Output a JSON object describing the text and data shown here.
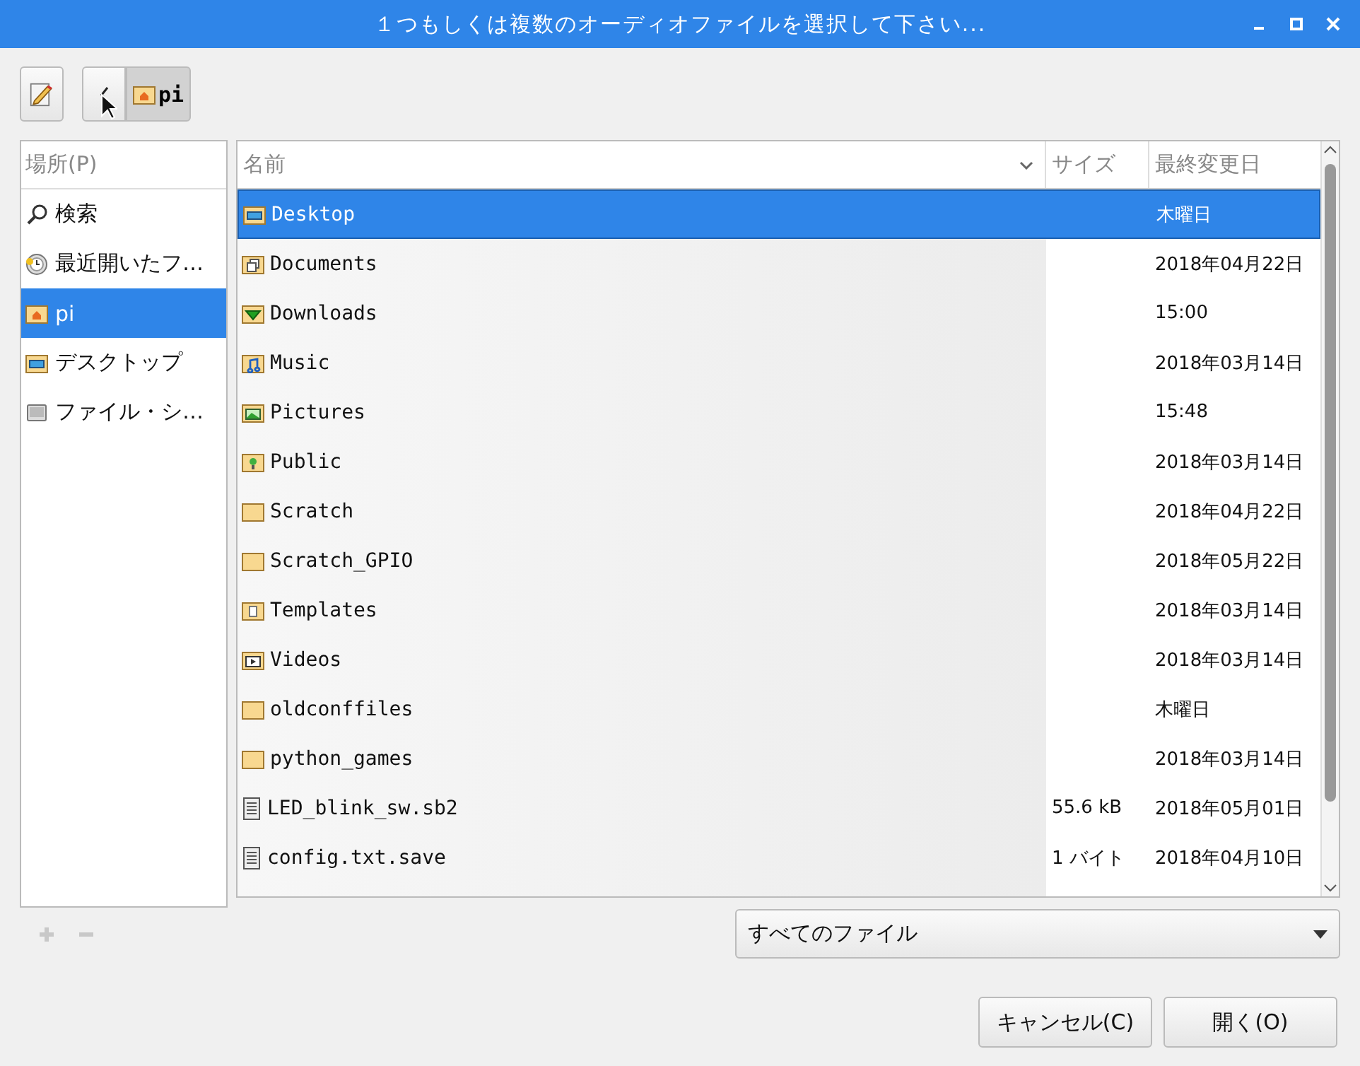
{
  "window": {
    "title": "１つもしくは複数のオーディオファイルを選択して下さい..."
  },
  "path_bar": {
    "crumbs": [
      {
        "label": "pi",
        "selected": true
      }
    ]
  },
  "sidebar": {
    "heading": "場所(P)",
    "items": [
      {
        "label": "検索",
        "kind": "search",
        "selected": false
      },
      {
        "label": "最近開いたフ…",
        "kind": "recent",
        "selected": false
      },
      {
        "label": "pi",
        "kind": "home",
        "selected": true
      },
      {
        "label": "デスクトップ",
        "kind": "desktop",
        "selected": false
      },
      {
        "label": "ファイル・シ…",
        "kind": "drive",
        "selected": false
      }
    ]
  },
  "table": {
    "columns": [
      "名前",
      "サイズ",
      "最終変更日"
    ],
    "rows": [
      {
        "name": "Desktop",
        "size": "",
        "modified": "木曜日",
        "kind": "desktop",
        "selected": true
      },
      {
        "name": "Documents",
        "size": "",
        "modified": "2018年04月22日",
        "kind": "documents",
        "selected": false
      },
      {
        "name": "Downloads",
        "size": "",
        "modified": "15:00",
        "kind": "downloads",
        "selected": false
      },
      {
        "name": "Music",
        "size": "",
        "modified": "2018年03月14日",
        "kind": "music",
        "selected": false
      },
      {
        "name": "Pictures",
        "size": "",
        "modified": "15:48",
        "kind": "pictures",
        "selected": false
      },
      {
        "name": "Public",
        "size": "",
        "modified": "2018年03月14日",
        "kind": "public",
        "selected": false
      },
      {
        "name": "Scratch",
        "size": "",
        "modified": "2018年04月22日",
        "kind": "folder",
        "selected": false
      },
      {
        "name": "Scratch_GPIO",
        "size": "",
        "modified": "2018年05月22日",
        "kind": "folder",
        "selected": false
      },
      {
        "name": "Templates",
        "size": "",
        "modified": "2018年03月14日",
        "kind": "templates",
        "selected": false
      },
      {
        "name": "Videos",
        "size": "",
        "modified": "2018年03月14日",
        "kind": "videos",
        "selected": false
      },
      {
        "name": "oldconffiles",
        "size": "",
        "modified": "木曜日",
        "kind": "folder",
        "selected": false
      },
      {
        "name": "python_games",
        "size": "",
        "modified": "2018年03月14日",
        "kind": "folder",
        "selected": false
      },
      {
        "name": "LED_blink_sw.sb2",
        "size": "55.6 kB",
        "modified": "2018年05月01日",
        "kind": "file",
        "selected": false
      },
      {
        "name": "config.txt.save",
        "size": "1 バイト",
        "modified": "2018年04月10日",
        "kind": "file",
        "selected": false
      }
    ]
  },
  "filter": {
    "value": "すべてのファイル"
  },
  "buttons": [
    {
      "label": "キャンセル(C)"
    },
    {
      "label": "開く(O)"
    }
  ]
}
